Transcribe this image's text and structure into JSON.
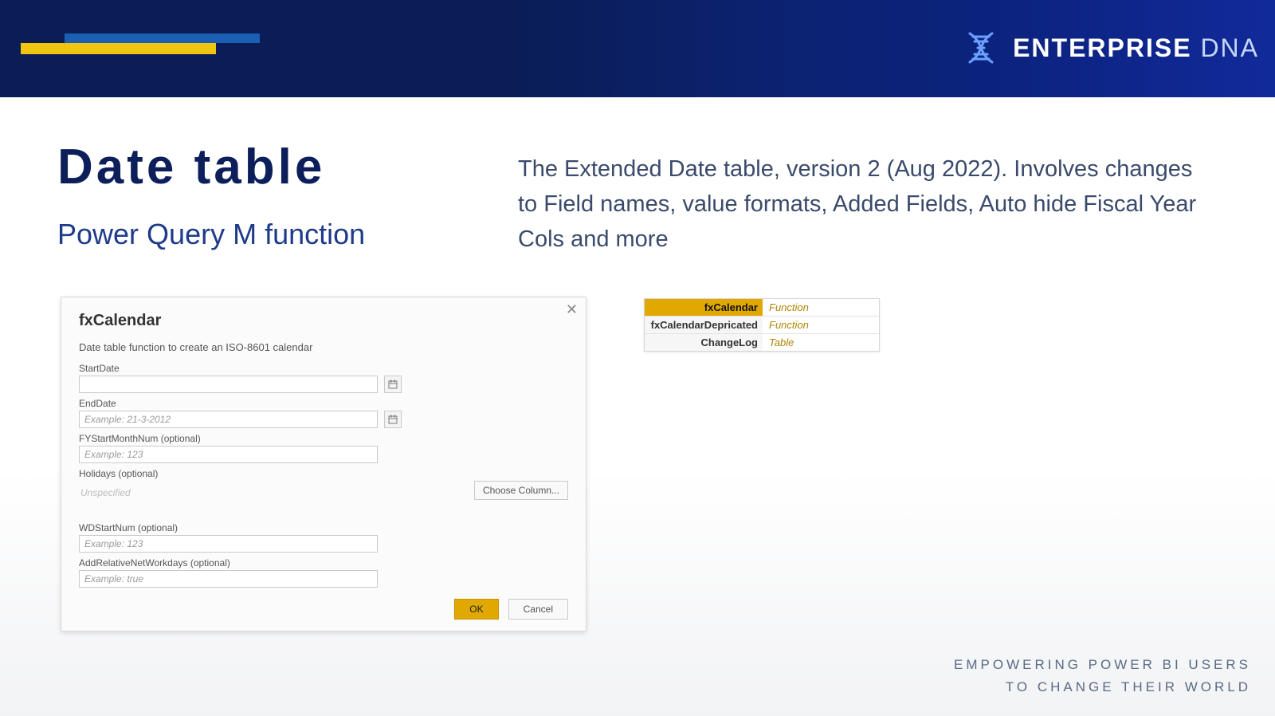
{
  "brand": {
    "name1": "ENTERPRISE",
    "name2": "DNA"
  },
  "title": "Date table",
  "subtitle": "Power Query M function",
  "description": "The Extended Date table, version 2 (Aug 2022). Involves changes to Field names, value formats, Added Fields, Auto hide Fiscal Year Cols and more",
  "dialog": {
    "title": "fxCalendar",
    "description": "Date table function to create an ISO-8601 calendar",
    "fields": {
      "startDate": {
        "label": "StartDate",
        "placeholder": ""
      },
      "endDate": {
        "label": "EndDate",
        "placeholder": "Example: 21-3-2012"
      },
      "fyStartMonthNum": {
        "label": "FYStartMonthNum (optional)",
        "placeholder": "Example: 123"
      },
      "holidays": {
        "label": "Holidays (optional)",
        "unspecified": "Unspecified",
        "chooseColumn": "Choose Column..."
      },
      "wdStartNum": {
        "label": "WDStartNum (optional)",
        "placeholder": "Example: 123"
      },
      "addRelativeNetWorkdays": {
        "label": "AddRelativeNetWorkdays (optional)",
        "placeholder": "Example: true"
      }
    },
    "buttons": {
      "ok": "OK",
      "cancel": "Cancel"
    }
  },
  "sideTable": {
    "rows": [
      {
        "name": "fxCalendar",
        "type": "Function",
        "active": true
      },
      {
        "name": "fxCalendarDepricated",
        "type": "Function",
        "active": false
      },
      {
        "name": "ChangeLog",
        "type": "Table",
        "active": false
      }
    ]
  },
  "tagline": {
    "line1": "EMPOWERING POWER BI USERS",
    "line2": "TO CHANGE THEIR WORLD"
  }
}
